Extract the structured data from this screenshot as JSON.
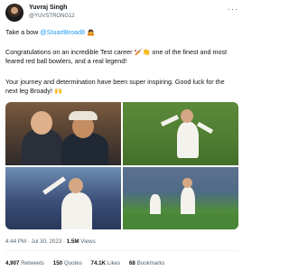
{
  "author": {
    "name": "Yuvraj Singh",
    "handle": "@YUVSTRONG12"
  },
  "tweet": {
    "line1_prefix": "Take a bow ",
    "mention": "@StuartBroad8",
    "line1_emoji": "🙇",
    "paragraph2": "Congratulations on an incredible Test career 🏏👏 one of the finest and most feared red ball bowlers, and a real legend!",
    "paragraph3": "Your journey and determination have been super inspiring. Good luck for the next leg Broady! 🙌"
  },
  "media": {
    "count": 4,
    "photos": [
      "photo-portrait-duo",
      "photo-celebration",
      "photo-applause",
      "photo-bowling"
    ]
  },
  "meta": {
    "time": "4:44 PM",
    "date": "Jul 30, 2023",
    "views_count": "1.5M",
    "views_label": "Views"
  },
  "stats": {
    "retweets_count": "4,907",
    "retweets_label": "Retweets",
    "quotes_count": "150",
    "quotes_label": "Quotes",
    "likes_count": "74.1K",
    "likes_label": "Likes",
    "bookmarks_count": "68",
    "bookmarks_label": "Bookmarks"
  }
}
